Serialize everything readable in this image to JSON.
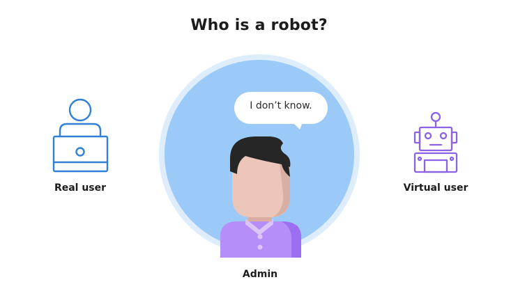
{
  "title": "Who is a robot?",
  "real_user": {
    "label": "Real user",
    "icon": "laptop-user-icon"
  },
  "admin": {
    "label": "Admin",
    "speech": "I don’t know.",
    "icon": "admin-avatar"
  },
  "virtual_user": {
    "label": "Virtual user",
    "icon": "robot-icon"
  },
  "colors": {
    "real_user_stroke": "#2f80d6",
    "robot_stroke": "#8a62e6",
    "circle_outer": "#deedfb",
    "circle_inner": "#9ccaf8",
    "hair": "#262626",
    "skin": "#ecc7b9",
    "shirt": "#b68ef9"
  }
}
